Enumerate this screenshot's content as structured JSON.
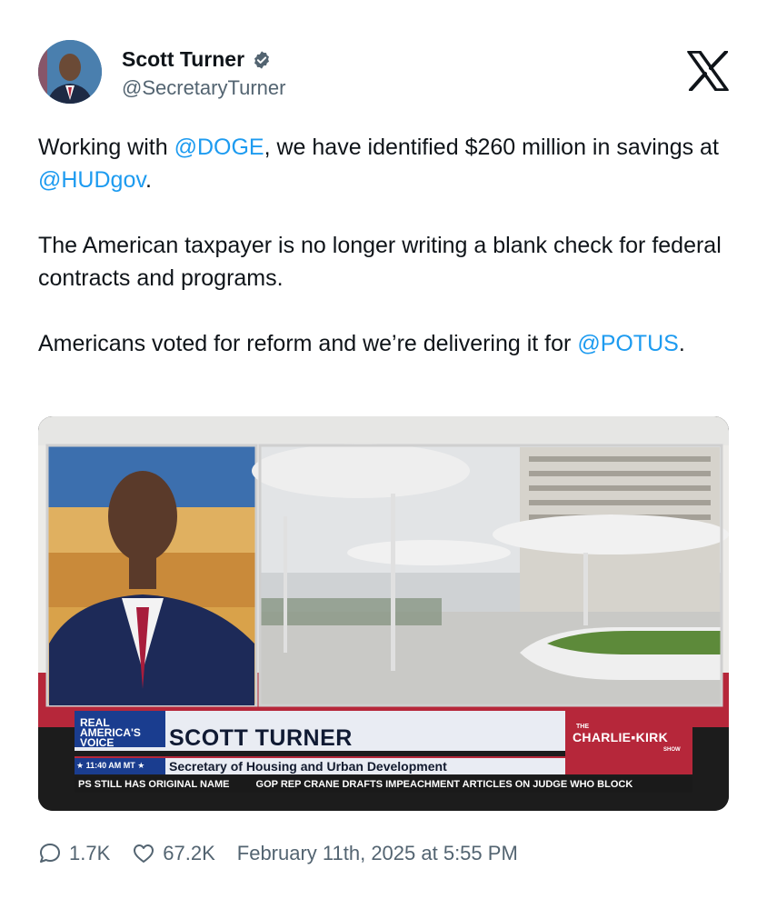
{
  "author": {
    "display_name": "Scott Turner",
    "handle": "@SecretaryTurner",
    "verified_icon": "verified-badge-icon"
  },
  "brand_icon": "x-logo-icon",
  "tweet": {
    "paragraphs": [
      {
        "parts": [
          {
            "text": "Working with "
          },
          {
            "text": "@DOGE",
            "mention": true
          },
          {
            "text": ", we have identified $260 million in savings at "
          },
          {
            "text": "@HUDgov",
            "mention": true
          },
          {
            "text": "."
          }
        ]
      },
      {
        "parts": [
          {
            "text": "The American taxpayer is no longer writing a blank check for federal contracts and programs."
          }
        ]
      },
      {
        "parts": [
          {
            "text": "Americans voted for reform and we’re delivering it for "
          },
          {
            "text": "@POTUS",
            "mention": true
          },
          {
            "text": "."
          }
        ]
      }
    ]
  },
  "media": {
    "network_logo_lines": [
      "REAL",
      "AMERICA'S",
      "VOICE"
    ],
    "chyron_name": "SCOTT TURNER",
    "chyron_title": "Secretary of Housing and Urban Development",
    "chyron_time": "★ 11:40 AM MT ★",
    "show_the": "THE",
    "show_name": "CHARLIE▪KIRK",
    "show_sub": "SHOW",
    "ticker_items": [
      "PS STILL HAS ORIGINAL NAME",
      "GOP REP CRANE DRAFTS IMPEACHMENT ARTICLES ON JUDGE WHO BLOCK"
    ]
  },
  "footer": {
    "replies": "1.7K",
    "likes": "67.2K",
    "timestamp": "February 11th, 2025 at 5:55 PM"
  },
  "colors": {
    "mention": "#1d9bf0",
    "secondary_text": "#536471",
    "verified_fill": "#536471"
  }
}
